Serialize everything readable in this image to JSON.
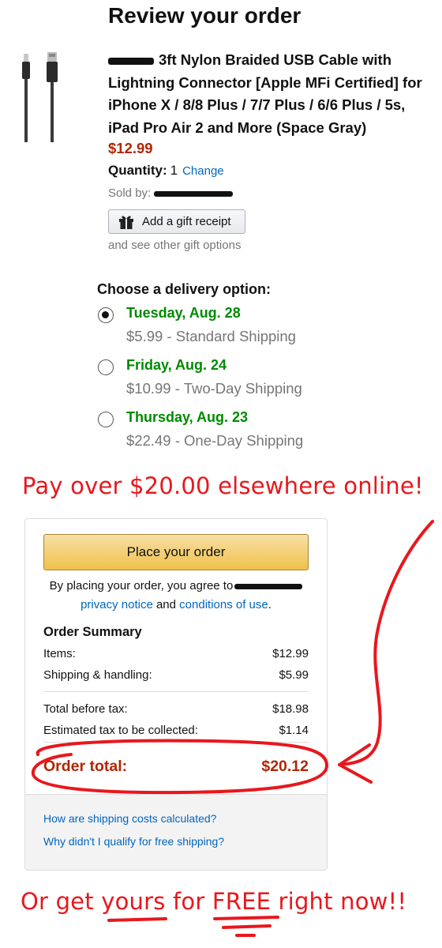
{
  "page": {
    "title": "Review your order"
  },
  "product": {
    "title": "3ft Nylon Braided USB Cable with Lightning Connector [Apple MFi Certified] for iPhone X / 8/8 Plus / 7/7 Plus / 6/6 Plus / 5s, iPad Pro Air 2 and More (Space Gray)",
    "price": "$12.99",
    "quantity_label": "Quantity:",
    "quantity_value": "1",
    "change_link": "Change",
    "sold_by_label": "Sold by:",
    "gift_button": "Add a gift receipt",
    "gift_more": "and see other gift options"
  },
  "delivery": {
    "heading": "Choose a delivery option:",
    "options": [
      {
        "date": "Tuesday, Aug. 28",
        "price": "$5.99",
        "method": " - Standard Shipping",
        "selected": true
      },
      {
        "date": "Friday, Aug. 24",
        "price": "$10.99",
        "method": " - Two-Day Shipping",
        "selected": false
      },
      {
        "date": "Thursday, Aug. 23",
        "price": "$22.49",
        "method": " - One-Day Shipping",
        "selected": false
      }
    ]
  },
  "annotations": {
    "pay_elsewhere": "Pay over $20.00 elsewhere online!",
    "free_prefix": "Or get ",
    "free_yours": "yours",
    "free_mid": " for ",
    "free_word": "FREE",
    "free_suffix": " right now!!",
    "color": "#e8171d"
  },
  "order_box": {
    "place_order": "Place your order",
    "agree_text": "By placing your order, you agree to",
    "privacy_link": "privacy notice",
    "and_text": " and ",
    "conditions_link": "conditions of use",
    "period": ".",
    "summary_title": "Order Summary",
    "rows": [
      {
        "label": "Items:",
        "value": "$12.99"
      },
      {
        "label": "Shipping & handling:",
        "value": "$5.99"
      },
      {
        "label": "Total before tax:",
        "value": "$18.98"
      },
      {
        "label": "Estimated tax to be collected:",
        "value": "$1.14"
      }
    ],
    "total_label": "Order total:",
    "total_value": "$20.12",
    "footer_links": [
      "How are shipping costs calculated?",
      "Why didn't I qualify for free shipping?"
    ]
  },
  "colors": {
    "price_red": "#b12704",
    "delivery_green": "#008a00",
    "link_blue": "#0066c0",
    "button_yellow": "#f0c14b"
  },
  "icons": {
    "gift": "gift-icon",
    "product": "lightning-cable-image"
  }
}
